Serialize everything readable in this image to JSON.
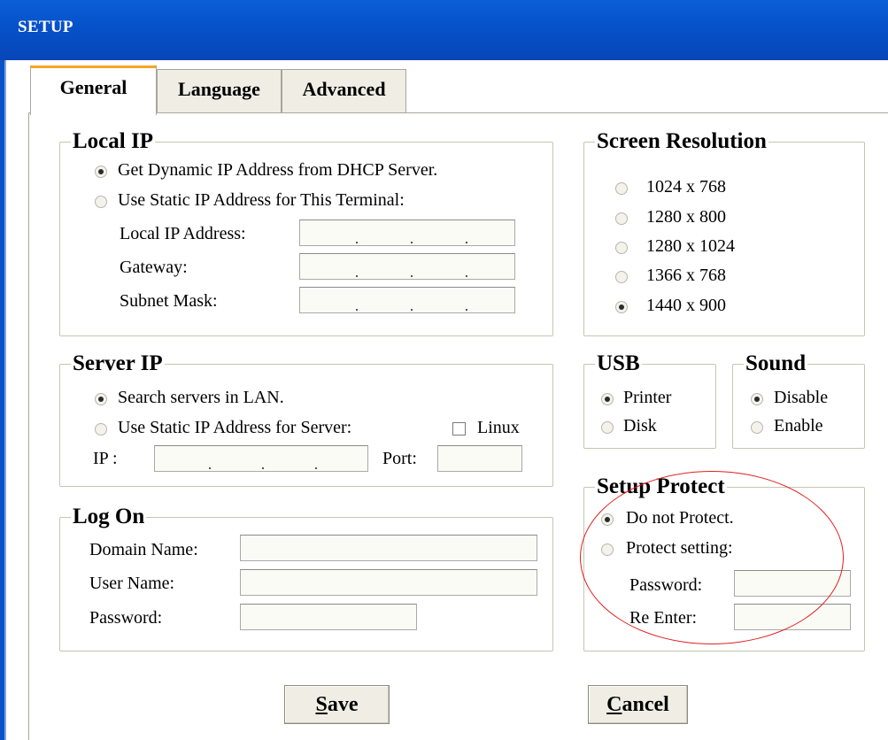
{
  "window": {
    "title": "SETUP"
  },
  "tabs": [
    {
      "label": "General",
      "active": true
    },
    {
      "label": "Language",
      "active": false
    },
    {
      "label": "Advanced",
      "active": false
    }
  ],
  "local_ip": {
    "legend": "Local IP",
    "options": [
      {
        "label": "Get Dynamic IP Address from DHCP Server.",
        "selected": true
      },
      {
        "label": "Use Static IP Address for This Terminal:",
        "selected": false
      }
    ],
    "local_ip_address_label": "Local IP Address:",
    "gateway_label": "Gateway:",
    "subnet_mask_label": "Subnet Mask:",
    "local_ip_address_value": "",
    "gateway_value": "",
    "subnet_mask_value": ""
  },
  "server_ip": {
    "legend": "Server IP",
    "options": [
      {
        "label": "Search servers in LAN.",
        "selected": true
      },
      {
        "label": "Use Static IP Address for Server:",
        "selected": false
      }
    ],
    "linux_label": "Linux",
    "linux_checked": false,
    "ip_label": "IP :",
    "port_label": "Port:",
    "ip_value": "",
    "port_value": ""
  },
  "log_on": {
    "legend": "Log On",
    "domain_label": "Domain Name:",
    "user_label": "User Name:",
    "password_label": "Password:",
    "domain_value": "",
    "user_value": "",
    "password_value": ""
  },
  "screen_resolution": {
    "legend": "Screen Resolution",
    "options": [
      {
        "label": "1024 x 768",
        "selected": false
      },
      {
        "label": "1280 x 800",
        "selected": false
      },
      {
        "label": "1280 x 1024",
        "selected": false
      },
      {
        "label": "1366 x 768",
        "selected": false
      },
      {
        "label": "1440 x 900",
        "selected": true
      }
    ]
  },
  "usb": {
    "legend": "USB",
    "options": [
      {
        "label": "Printer",
        "selected": true
      },
      {
        "label": "Disk",
        "selected": false
      }
    ]
  },
  "sound": {
    "legend": "Sound",
    "options": [
      {
        "label": "Disable",
        "selected": true
      },
      {
        "label": "Enable",
        "selected": false
      }
    ]
  },
  "setup_protect": {
    "legend": "Setup Protect",
    "options": [
      {
        "label": "Do not Protect.",
        "selected": true
      },
      {
        "label": "Protect setting:",
        "selected": false
      }
    ],
    "password_label": "Password:",
    "reenter_label": "Re Enter:",
    "password_value": "",
    "reenter_value": ""
  },
  "buttons": {
    "save_mnemonic": "S",
    "save_rest": "ave",
    "cancel_mnemonic": "C",
    "cancel_rest": "ancel"
  },
  "colors": {
    "titlebar": "#0651c9",
    "annotation": "#e02020",
    "tab_highlight": "#f5a623",
    "group_border": "#c7c5b2"
  }
}
